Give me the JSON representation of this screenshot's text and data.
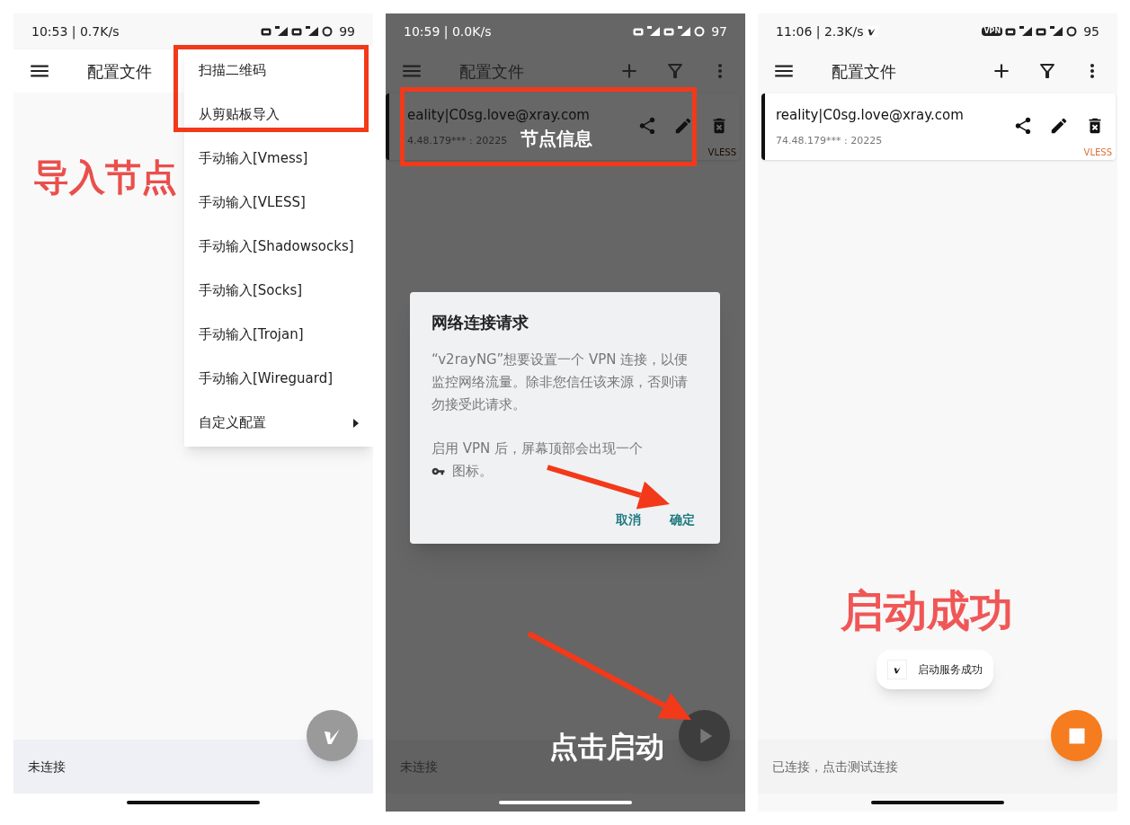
{
  "panels": [
    {
      "dimmed": false,
      "status_bar": {
        "time": "10:53 | 0.7K/s",
        "battery": "99"
      },
      "toolbar": {
        "title": "配置文件"
      },
      "menu": {
        "items": [
          {
            "label": "扫描二维码",
            "submenu": false
          },
          {
            "label": "从剪贴板导入",
            "submenu": false
          },
          {
            "label": "手动输入[Vmess]",
            "submenu": false
          },
          {
            "label": "手动输入[VLESS]",
            "submenu": false
          },
          {
            "label": "手动输入[Shadowsocks]",
            "submenu": false
          },
          {
            "label": "手动输入[Socks]",
            "submenu": false
          },
          {
            "label": "手动输入[Trojan]",
            "submenu": false
          },
          {
            "label": "手动输入[Wireguard]",
            "submenu": false
          },
          {
            "label": "自定义配置",
            "submenu": true
          }
        ]
      },
      "fab": {
        "kind": "logo"
      },
      "status": "未连接",
      "callouts": [
        "导入节点"
      ]
    },
    {
      "dimmed": true,
      "status_bar": {
        "time": "10:59 | 0.0K/s",
        "battery": "97"
      },
      "toolbar": {
        "title": "配置文件",
        "actions": true
      },
      "card": {
        "title": "eality|C0sg.love@xray.com",
        "address": "4.48.179*** : 20225",
        "protocol": "VLESS",
        "swiped": true
      },
      "dialog": {
        "title": "网络连接请求",
        "text": "“v2rayNG”想要设置一个 VPN 连接，以便监控网络流量。除非您信任该来源，否则请勿接受此请求。",
        "note_before": "启用 VPN 后，屏幕顶部会出现一个",
        "note_after": "图标。",
        "buttons": [
          "取消",
          "确定"
        ]
      },
      "fab": {
        "kind": "play"
      },
      "status": "未连接",
      "callouts": [
        "节点信息",
        "点击启动"
      ]
    },
    {
      "dimmed": false,
      "status_bar": {
        "time": "11:06 | 2.3K/s",
        "vpn_badge": "VPN",
        "battery": "95"
      },
      "toolbar": {
        "title": "配置文件",
        "actions": true
      },
      "card": {
        "title": "reality|C0sg.love@xray.com",
        "address": "74.48.179*** : 20225",
        "protocol": "VLESS",
        "swiped": false
      },
      "toast": {
        "message": "启动服务成功"
      },
      "fab": {
        "kind": "stop"
      },
      "status": "已连接，点击测试连接",
      "callouts": [
        "启动成功"
      ]
    }
  ]
}
